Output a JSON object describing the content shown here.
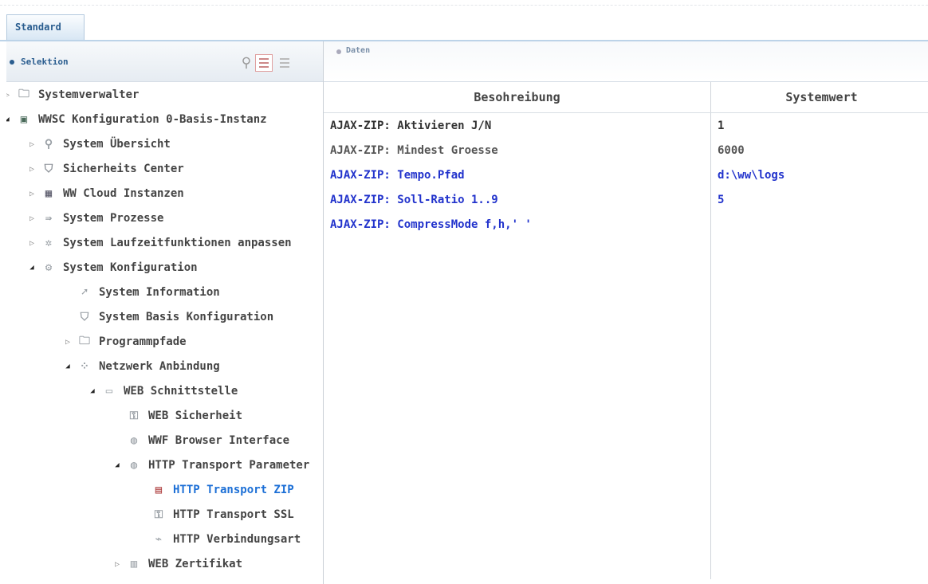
{
  "tab": {
    "label": "Standard"
  },
  "left": {
    "header_label": "Selektion",
    "tree": [
      {
        "label": "Systemverwalter",
        "toggle": "▷",
        "icon": "folder-icon",
        "level": 0
      },
      {
        "label": "WWSC Konfiguration 0-Basis-Instanz",
        "toggle": "◢",
        "icon": "config-icon",
        "level": 0
      },
      {
        "label": "System Übersicht",
        "toggle": "▷",
        "icon": "search-icon",
        "level": 1
      },
      {
        "label": "Sicherheits Center",
        "toggle": "▷",
        "icon": "shield-icon",
        "level": 1
      },
      {
        "label": "WW Cloud Instanzen",
        "toggle": "▷",
        "icon": "cloud-server-icon",
        "level": 1
      },
      {
        "label": "System Prozesse",
        "toggle": "▷",
        "icon": "process-icon",
        "level": 1
      },
      {
        "label": "System Laufzeitfunktionen anpassen",
        "toggle": "▷",
        "icon": "runtime-icon",
        "level": 1
      },
      {
        "label": "System Konfiguration",
        "toggle": "◢",
        "icon": "gear-icon",
        "level": 1
      },
      {
        "label": "System Information",
        "toggle": "",
        "icon": "info-arrow-icon",
        "level": 2
      },
      {
        "label": "System Basis Konfiguration",
        "toggle": "",
        "icon": "shield-small-icon",
        "level": 2
      },
      {
        "label": "Programmpfade",
        "toggle": "▷",
        "icon": "folder-icon",
        "level": 2
      },
      {
        "label": "Netzwerk Anbindung",
        "toggle": "◢",
        "icon": "network-icon",
        "level": 2
      },
      {
        "label": "WEB Schnittstelle",
        "toggle": "◢",
        "icon": "web-interface-icon",
        "level": 3
      },
      {
        "label": "WEB Sicherheit",
        "toggle": "",
        "icon": "key-icon",
        "level": 4
      },
      {
        "label": "WWF Browser Interface",
        "toggle": "",
        "icon": "globe-icon",
        "level": 4
      },
      {
        "label": "HTTP Transport Parameter",
        "toggle": "◢",
        "icon": "globe-icon",
        "level": 4
      },
      {
        "label": "HTTP Transport ZIP",
        "toggle": "",
        "icon": "zip-archive-icon",
        "level": 5,
        "selected": true
      },
      {
        "label": "HTTP Transport SSL",
        "toggle": "",
        "icon": "key-icon",
        "level": 5
      },
      {
        "label": "HTTP Verbindungsart",
        "toggle": "",
        "icon": "plug-icon",
        "level": 5
      },
      {
        "label": "WEB Zertifikat",
        "toggle": "▷",
        "icon": "certificate-icon",
        "level": 4
      }
    ]
  },
  "right": {
    "header_label": "Daten",
    "columns": [
      "Besohreibung",
      "Systemwert"
    ],
    "rows": [
      {
        "desc": "AJAX-ZIP: Aktivieren J/N",
        "value": "1"
      },
      {
        "desc": "AJAX-ZIP: Mindest Groesse",
        "value": "6000"
      },
      {
        "desc": "AJAX-ZIP: Tempo.Pfad",
        "value": "d:\\ww\\logs"
      },
      {
        "desc": "AJAX-ZIP: Soll-Ratio 1..9",
        "value": "5"
      },
      {
        "desc": "AJAX-ZIP: CompressMode f,h,' '",
        "value": ""
      }
    ]
  }
}
